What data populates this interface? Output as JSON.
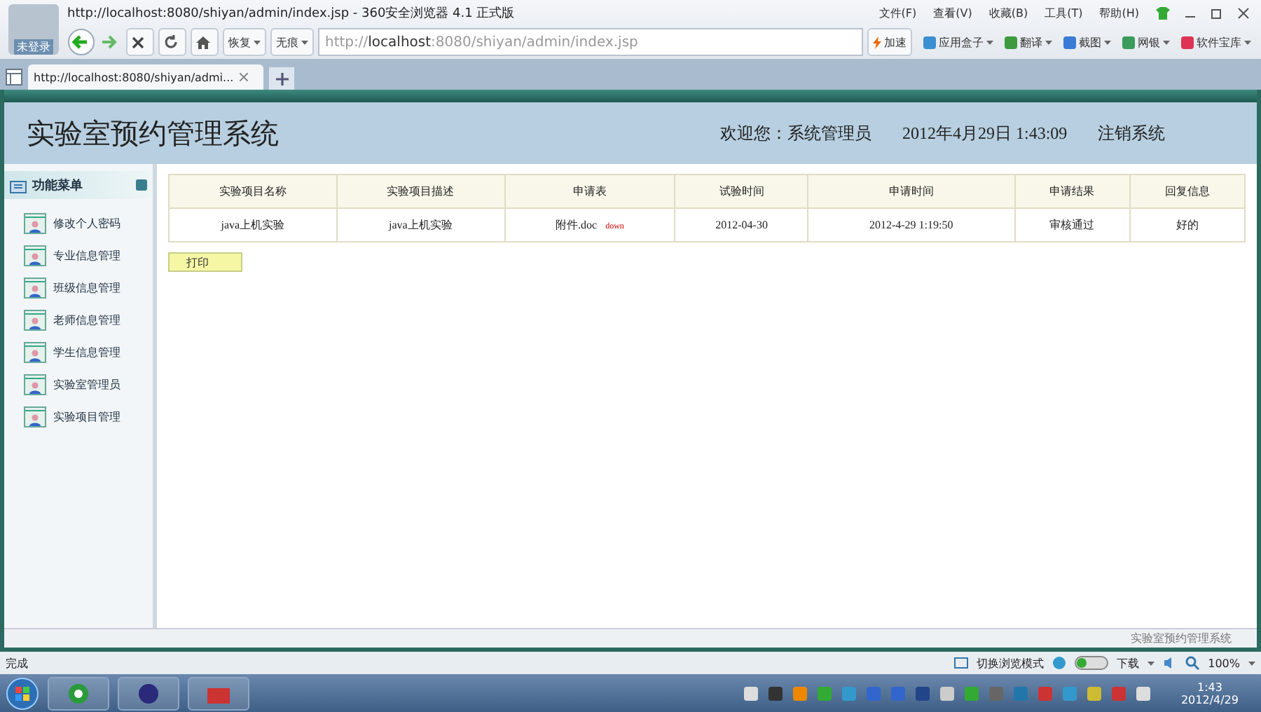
{
  "browser": {
    "title": "http://localhost:8080/shiyan/admin/index.jsp - 360安全浏览器 4.1 正式版",
    "login": "未登录",
    "menu": [
      "文件(F)",
      "查看(V)",
      "收藏(B)",
      "工具(T)",
      "帮助(H)"
    ],
    "restore": "恢复",
    "incognito": "无痕",
    "address": {
      "scheme": "http://",
      "host": "localhost",
      "rest": ":8080/shiyan/admin/index.jsp"
    },
    "speedup": "加速",
    "apps": [
      "应用盒子",
      "翻译",
      "截图",
      "网银",
      "软件宝库"
    ],
    "tabs": [
      {
        "label": "http://localhost:8080/shiyan/admi...",
        "selected": true
      }
    ]
  },
  "page": {
    "title": "实验室预约管理系统",
    "welcome": "欢迎您：系统管理员",
    "datetime": "2012年4月29日 1:43:09",
    "logout": "注销系统",
    "menu_title": "功能菜单",
    "menu": [
      "修改个人密码",
      "专业信息管理",
      "班级信息管理",
      "老师信息管理",
      "学生信息管理",
      "实验室管理员",
      "实验项目管理"
    ],
    "table": {
      "columns": [
        "实验项目名称",
        "实验项目描述",
        "申请表",
        "试验时间",
        "申请时间",
        "申请结果",
        "回复信息"
      ],
      "rows": [
        {
          "name": "java上机实验",
          "desc": "java上机实验",
          "file": "附件.doc",
          "file_link": "down",
          "date": "2012-04-30",
          "applied": "2012-4-29 1:19:50",
          "result": "审核通过",
          "reply": "好的"
        }
      ]
    },
    "print": "打印",
    "footer": "实验室预约管理系统"
  },
  "status_bar": {
    "left": "完成",
    "mode": "切换浏览模式",
    "download": "下载",
    "zoom": "100%"
  },
  "taskbar": {
    "time": "1:43",
    "date": "2012/4/29"
  }
}
